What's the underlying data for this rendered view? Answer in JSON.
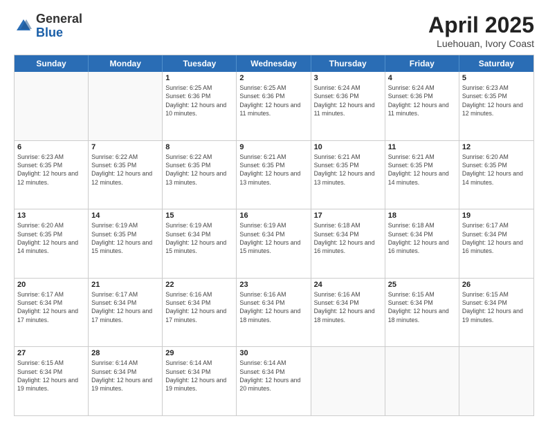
{
  "header": {
    "logo": {
      "general": "General",
      "blue": "Blue"
    },
    "title": "April 2025",
    "location": "Luehouan, Ivory Coast"
  },
  "weekdays": [
    "Sunday",
    "Monday",
    "Tuesday",
    "Wednesday",
    "Thursday",
    "Friday",
    "Saturday"
  ],
  "rows": [
    [
      {
        "day": "",
        "info": ""
      },
      {
        "day": "",
        "info": ""
      },
      {
        "day": "1",
        "info": "Sunrise: 6:25 AM\nSunset: 6:36 PM\nDaylight: 12 hours and 10 minutes."
      },
      {
        "day": "2",
        "info": "Sunrise: 6:25 AM\nSunset: 6:36 PM\nDaylight: 12 hours and 11 minutes."
      },
      {
        "day": "3",
        "info": "Sunrise: 6:24 AM\nSunset: 6:36 PM\nDaylight: 12 hours and 11 minutes."
      },
      {
        "day": "4",
        "info": "Sunrise: 6:24 AM\nSunset: 6:36 PM\nDaylight: 12 hours and 11 minutes."
      },
      {
        "day": "5",
        "info": "Sunrise: 6:23 AM\nSunset: 6:35 PM\nDaylight: 12 hours and 12 minutes."
      }
    ],
    [
      {
        "day": "6",
        "info": "Sunrise: 6:23 AM\nSunset: 6:35 PM\nDaylight: 12 hours and 12 minutes."
      },
      {
        "day": "7",
        "info": "Sunrise: 6:22 AM\nSunset: 6:35 PM\nDaylight: 12 hours and 12 minutes."
      },
      {
        "day": "8",
        "info": "Sunrise: 6:22 AM\nSunset: 6:35 PM\nDaylight: 12 hours and 13 minutes."
      },
      {
        "day": "9",
        "info": "Sunrise: 6:21 AM\nSunset: 6:35 PM\nDaylight: 12 hours and 13 minutes."
      },
      {
        "day": "10",
        "info": "Sunrise: 6:21 AM\nSunset: 6:35 PM\nDaylight: 12 hours and 13 minutes."
      },
      {
        "day": "11",
        "info": "Sunrise: 6:21 AM\nSunset: 6:35 PM\nDaylight: 12 hours and 14 minutes."
      },
      {
        "day": "12",
        "info": "Sunrise: 6:20 AM\nSunset: 6:35 PM\nDaylight: 12 hours and 14 minutes."
      }
    ],
    [
      {
        "day": "13",
        "info": "Sunrise: 6:20 AM\nSunset: 6:35 PM\nDaylight: 12 hours and 14 minutes."
      },
      {
        "day": "14",
        "info": "Sunrise: 6:19 AM\nSunset: 6:35 PM\nDaylight: 12 hours and 15 minutes."
      },
      {
        "day": "15",
        "info": "Sunrise: 6:19 AM\nSunset: 6:34 PM\nDaylight: 12 hours and 15 minutes."
      },
      {
        "day": "16",
        "info": "Sunrise: 6:19 AM\nSunset: 6:34 PM\nDaylight: 12 hours and 15 minutes."
      },
      {
        "day": "17",
        "info": "Sunrise: 6:18 AM\nSunset: 6:34 PM\nDaylight: 12 hours and 16 minutes."
      },
      {
        "day": "18",
        "info": "Sunrise: 6:18 AM\nSunset: 6:34 PM\nDaylight: 12 hours and 16 minutes."
      },
      {
        "day": "19",
        "info": "Sunrise: 6:17 AM\nSunset: 6:34 PM\nDaylight: 12 hours and 16 minutes."
      }
    ],
    [
      {
        "day": "20",
        "info": "Sunrise: 6:17 AM\nSunset: 6:34 PM\nDaylight: 12 hours and 17 minutes."
      },
      {
        "day": "21",
        "info": "Sunrise: 6:17 AM\nSunset: 6:34 PM\nDaylight: 12 hours and 17 minutes."
      },
      {
        "day": "22",
        "info": "Sunrise: 6:16 AM\nSunset: 6:34 PM\nDaylight: 12 hours and 17 minutes."
      },
      {
        "day": "23",
        "info": "Sunrise: 6:16 AM\nSunset: 6:34 PM\nDaylight: 12 hours and 18 minutes."
      },
      {
        "day": "24",
        "info": "Sunrise: 6:16 AM\nSunset: 6:34 PM\nDaylight: 12 hours and 18 minutes."
      },
      {
        "day": "25",
        "info": "Sunrise: 6:15 AM\nSunset: 6:34 PM\nDaylight: 12 hours and 18 minutes."
      },
      {
        "day": "26",
        "info": "Sunrise: 6:15 AM\nSunset: 6:34 PM\nDaylight: 12 hours and 19 minutes."
      }
    ],
    [
      {
        "day": "27",
        "info": "Sunrise: 6:15 AM\nSunset: 6:34 PM\nDaylight: 12 hours and 19 minutes."
      },
      {
        "day": "28",
        "info": "Sunrise: 6:14 AM\nSunset: 6:34 PM\nDaylight: 12 hours and 19 minutes."
      },
      {
        "day": "29",
        "info": "Sunrise: 6:14 AM\nSunset: 6:34 PM\nDaylight: 12 hours and 19 minutes."
      },
      {
        "day": "30",
        "info": "Sunrise: 6:14 AM\nSunset: 6:34 PM\nDaylight: 12 hours and 20 minutes."
      },
      {
        "day": "",
        "info": ""
      },
      {
        "day": "",
        "info": ""
      },
      {
        "day": "",
        "info": ""
      }
    ]
  ]
}
